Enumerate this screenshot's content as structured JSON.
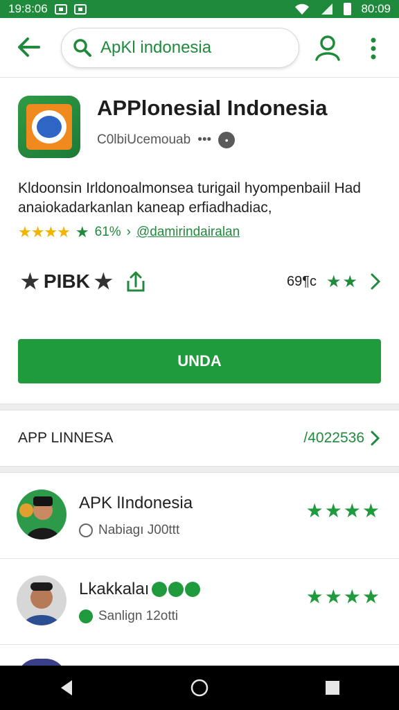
{
  "status_bar": {
    "time": "19:8:06",
    "clock_right": "80:09"
  },
  "search": {
    "query": "ApKl indonesia"
  },
  "app": {
    "title": "APPlonesial Indonesia",
    "developer": "C0lbiUcemouab",
    "developer_more": "•••",
    "description": "Kldoonsin Irldonoalmonsea turigail hyompenbaiil Had anaiokadarkanlan kaneap erfiadhadiac,",
    "rating_pct": "61%",
    "rating_sep": "›",
    "developer_link": "@damirindairalan",
    "stat_label": "PIBK",
    "downloads": "69¶c",
    "install_label": "UNDA"
  },
  "section": {
    "title": "APP LINNESA",
    "count": "/4022536"
  },
  "list": [
    {
      "name": "APK lIndonesia",
      "sub": "Nabiagı J00ttt",
      "stars": "★★★★"
    },
    {
      "name": "Lkakkalaı",
      "sub": "Sanlign 12otti",
      "stars": "★★★★"
    }
  ],
  "colors": {
    "brand_green": "#1f8a3c",
    "install_green": "#1f9a3c",
    "rating_yellow": "#f2b400"
  },
  "icons": [
    "wifi-icon",
    "signal-icon",
    "battery-icon",
    "back-arrow-icon",
    "search-icon",
    "account-icon",
    "more-vert-icon",
    "share-icon",
    "chevron-right-icon",
    "nav-back-icon",
    "nav-home-icon",
    "nav-recents-icon"
  ]
}
